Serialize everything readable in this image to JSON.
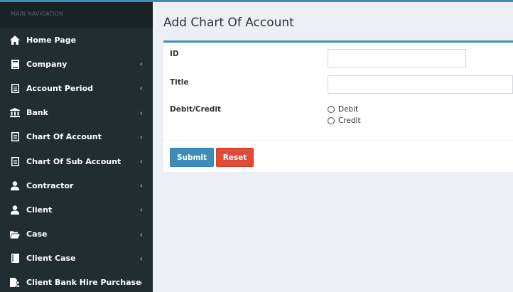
{
  "sidebar": {
    "header": "MAIN NAVIGATION",
    "items": [
      {
        "label": "Home Page",
        "icon": "home-icon",
        "chevron": ""
      },
      {
        "label": "Company",
        "icon": "book-icon",
        "chevron": "‹"
      },
      {
        "label": "Account Period",
        "icon": "file-icon",
        "chevron": "‹"
      },
      {
        "label": "Bank",
        "icon": "bank-icon",
        "chevron": "‹"
      },
      {
        "label": "Chart Of Account",
        "icon": "file-icon",
        "chevron": "‹"
      },
      {
        "label": "Chart Of Sub Account",
        "icon": "file-icon",
        "chevron": "‹"
      },
      {
        "label": "Contractor",
        "icon": "user-icon",
        "chevron": "‹"
      },
      {
        "label": "Client",
        "icon": "user-icon",
        "chevron": "‹"
      },
      {
        "label": "Case",
        "icon": "folder-open-icon",
        "chevron": "‹"
      },
      {
        "label": "Client Case",
        "icon": "book-icon",
        "chevron": "‹"
      },
      {
        "label": "Client Bank Hire Purchase",
        "icon": "file-user-icon",
        "chevron": "‹"
      }
    ]
  },
  "main": {
    "title": "Add Chart Of Account",
    "form": {
      "id_label": "ID",
      "id_value": "",
      "title_label": "Title",
      "title_value": "",
      "type_label": "Debit/Credit",
      "options": [
        "Debit",
        "Credit"
      ]
    },
    "buttons": {
      "submit": "Submit",
      "reset": "Reset"
    }
  },
  "colors": {
    "sidebar_bg": "#222d32",
    "accent": "#3c8dbc",
    "danger": "#dd4b39"
  }
}
